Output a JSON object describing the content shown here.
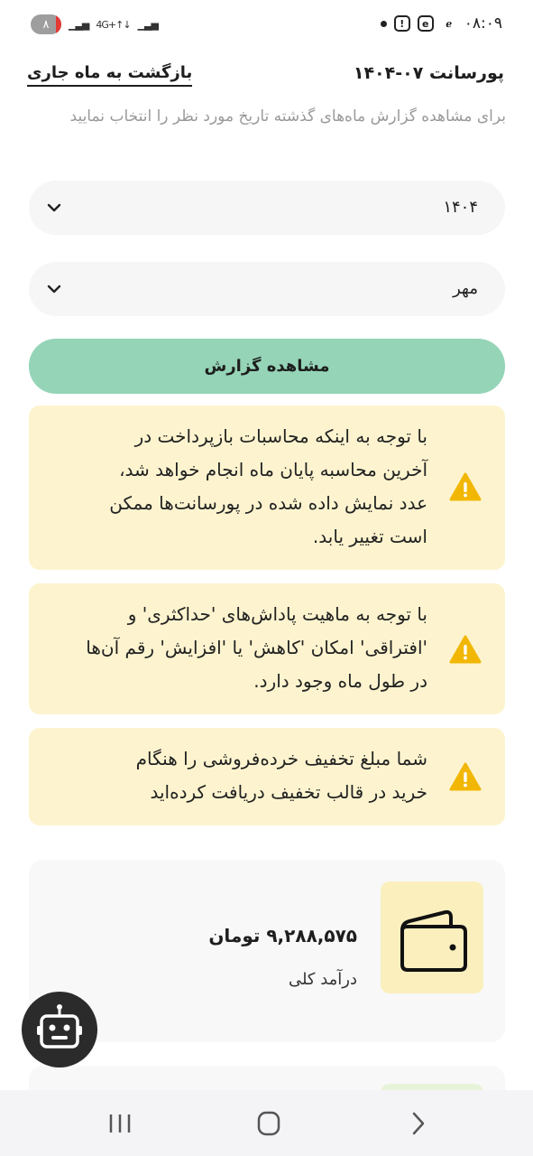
{
  "status_bar": {
    "time": "۰۸:۰۹",
    "battery_level": "۸",
    "network_label": "4G+",
    "icons": [
      "battery-icon",
      "signal-icon",
      "network-icon",
      "wifi-calling-icon",
      "app-icon",
      "app-icon",
      "alert-icon",
      "dot-icon"
    ]
  },
  "header": {
    "title": "پورسانت  ۰۷-۱۴۰۴",
    "back_link": "بازگشت به ماه جاری"
  },
  "subtitle": "برای مشاهده گزارش ماه‌های گذشته تاریخ مورد نظر را انتخاب نمایید",
  "filters": {
    "year_value": "۱۴۰۴",
    "month_value": "مهر"
  },
  "report_button": "مشاهده گزارش",
  "notices": [
    {
      "lines": [
        "با توجه به اینکه محاسبات بازپرداخت در",
        "آخرین محاسبه پایان ماه انجام خواهد شد،",
        "عدد نمایش داده شده در پورسانت‌ها ممکن",
        "است تغییر یابد."
      ]
    },
    {
      "lines": [
        "با توجه به ماهیت پاداش‌های 'حداکثری' و",
        "'افتراقی' امکان 'کاهش' یا 'افزایش' رقم آن‌ها",
        "در طول ماه وجود دارد."
      ]
    },
    {
      "lines": [
        "شما مبلغ تخفیف خرده‌فروشی را هنگام",
        "خرید در قالب تخفیف دریافت کرده‌اید"
      ]
    }
  ],
  "income_card": {
    "amount": "۹,۲۸۸,۵۷۵ تومان",
    "label": "درآمد کلی",
    "icon": "wallet-icon"
  },
  "colors": {
    "primary_button": "#95d4b7",
    "notice_bg": "#fdf4cf",
    "warning": "#f2b705",
    "wallet_bg": "#fbefbe"
  }
}
